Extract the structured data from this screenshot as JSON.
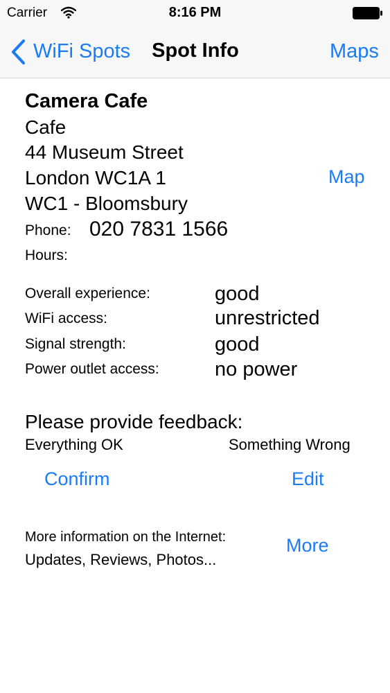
{
  "status_bar": {
    "carrier": "Carrier",
    "time": "8:16 PM"
  },
  "nav": {
    "back_label": "WiFi Spots",
    "title": "Spot Info",
    "right_label": "Maps"
  },
  "spot": {
    "name": "Camera Cafe",
    "category": "Cafe",
    "street": "44 Museum Street",
    "city": "London WC1A 1",
    "area": "WC1 - Bloomsbury",
    "map_link": "Map",
    "phone_label": "Phone:",
    "phone": "020 7831 1566",
    "hours_label": "Hours:"
  },
  "ratings": [
    {
      "label": "Overall experience:",
      "value": "good"
    },
    {
      "label": "WiFi access:",
      "value": "unrestricted"
    },
    {
      "label": "Signal strength:",
      "value": "good"
    },
    {
      "label": "Power outlet access:",
      "value": "no power"
    }
  ],
  "feedback": {
    "title": "Please provide feedback:",
    "ok_label": "Everything OK",
    "wrong_label": "Something Wrong",
    "confirm": "Confirm",
    "edit": "Edit"
  },
  "more": {
    "info": "More information on the Internet:",
    "sub": "Updates, Reviews, Photos...",
    "button": "More"
  },
  "colors": {
    "accent": "#1a7cf5",
    "bar_bg": "#f7f7f7"
  },
  "icons": {
    "wifi": "wifi-icon",
    "battery": "battery-icon",
    "back": "chevron-left-icon"
  }
}
